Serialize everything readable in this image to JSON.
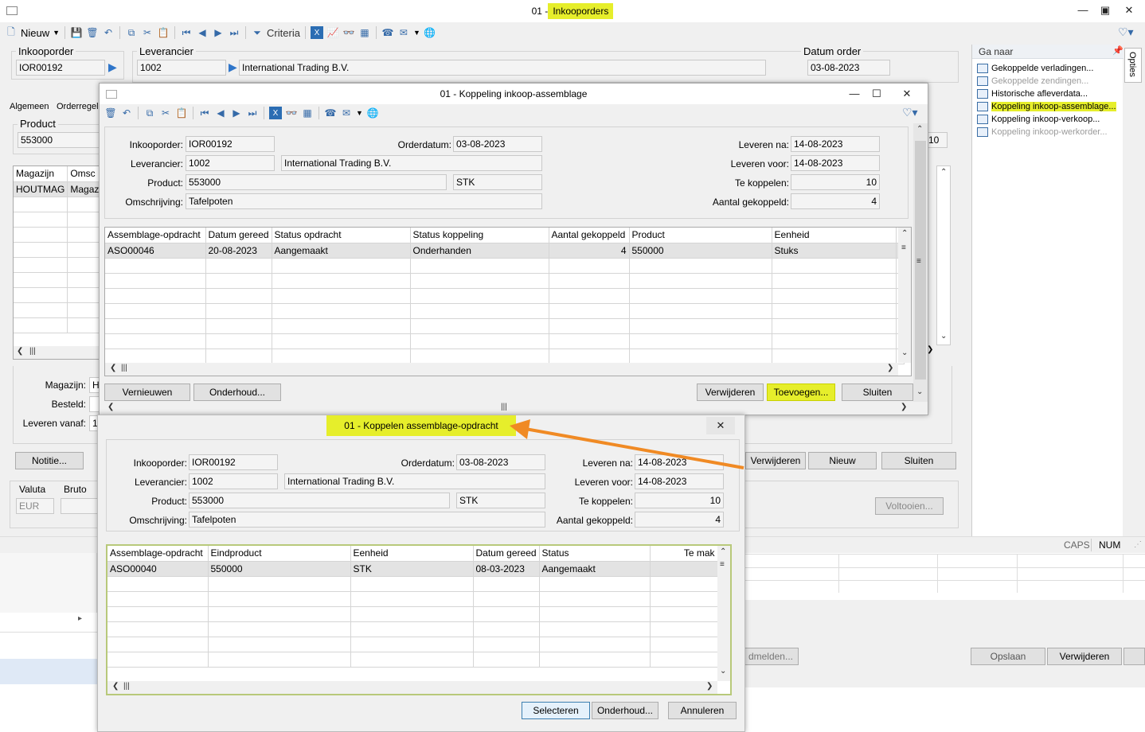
{
  "main": {
    "title_prefix": "01 - ",
    "title": "Inkooporders",
    "toolbar": {
      "new_label": "Nieuw",
      "criteria_label": "Criteria"
    },
    "order_label": "Inkooporder",
    "order_value": "IOR00192",
    "supplier_label": "Leverancier",
    "supplier_code": "1002",
    "supplier_name": "International Trading B.V.",
    "date_label": "Datum order",
    "date_value": "03-08-2023",
    "tabs": [
      "Algemeen",
      "Orderregel"
    ],
    "product_label": "Product",
    "product_value": "553000",
    "right_value": "10",
    "grid_headers": [
      "Magazijn",
      "Omsc"
    ],
    "grid_row": [
      "HOUTMAG",
      "Magaz"
    ],
    "magazijn_label": "Magazijn:",
    "magazijn_value": "H",
    "besteld_label": "Besteld:",
    "leveren_vanaf_label": "Leveren vanaf:",
    "leveren_vanaf_value": "1",
    "notitie_btn": "Notitie...",
    "verwijderen_btn": "Verwijderen",
    "nieuw_btn": "Nieuw",
    "sluiten_btn": "Sluiten",
    "valuta_label": "Valuta",
    "bruto_label": "Bruto",
    "valuta_value": "EUR",
    "voltooien_btn": "Voltooien...",
    "status_caps": "CAPS",
    "status_num": "NUM",
    "bottom_btns": {
      "afmelden": "dmelden...",
      "opslaan": "Opslaan",
      "verwijderen": "Verwijderen"
    }
  },
  "goto": {
    "title": "Ga naar",
    "tab": "Opties",
    "items": [
      {
        "label": "Gekoppelde verladingen...",
        "disabled": false
      },
      {
        "label": "Gekoppelde zendingen...",
        "disabled": true
      },
      {
        "label": "Historische afleverdata...",
        "disabled": false
      },
      {
        "label": "Koppeling inkoop-assemblage...",
        "disabled": false
      },
      {
        "label": "Koppeling inkoop-verkoop...",
        "disabled": false
      },
      {
        "label": "Koppeling inkoop-werkorder...",
        "disabled": true
      }
    ]
  },
  "dlg1": {
    "title": "01 - Koppeling inkoop-assemblage",
    "inkooporder_label": "Inkooporder:",
    "inkooporder": "IOR00192",
    "orderdatum_label": "Orderdatum:",
    "orderdatum": "03-08-2023",
    "leveren_na_label": "Leveren na:",
    "leveren_na": "14-08-2023",
    "leverancier_label": "Leverancier:",
    "leverancier_code": "1002",
    "leverancier_name": "International Trading B.V.",
    "leveren_voor_label": "Leveren voor:",
    "leveren_voor": "14-08-2023",
    "product_label": "Product:",
    "product": "553000",
    "unit": "STK",
    "te_koppelen_label": "Te koppelen:",
    "te_koppelen": "10",
    "omschrijving_label": "Omschrijving:",
    "omschrijving": "Tafelpoten",
    "aantal_gekoppeld_label": "Aantal gekoppeld:",
    "aantal_gekoppeld": "4",
    "headers": [
      "Assemblage-opdracht",
      "Datum gereed",
      "Status opdracht",
      "Status koppeling",
      "Aantal gekoppeld",
      "Product",
      "Eenheid",
      "("
    ],
    "rows": [
      [
        "ASO00046",
        "20-08-2023",
        "Aangemaakt",
        "Onderhanden",
        "4",
        "550000",
        "Stuks",
        ""
      ]
    ],
    "btn_vernieuwen": "Vernieuwen",
    "btn_onderhoud": "Onderhoud...",
    "btn_verwijderen": "Verwijderen",
    "btn_toevoegen": "Toevoegen...",
    "btn_sluiten": "Sluiten"
  },
  "dlg2": {
    "title": "01 - Koppelen assemblage-opdracht",
    "inkooporder_label": "Inkooporder:",
    "inkooporder": "IOR00192",
    "orderdatum_label": "Orderdatum:",
    "orderdatum": "03-08-2023",
    "leveren_na_label": "Leveren na:",
    "leveren_na": "14-08-2023",
    "leverancier_label": "Leverancier:",
    "leverancier_code": "1002",
    "leverancier_name": "International Trading B.V.",
    "leveren_voor_label": "Leveren voor:",
    "leveren_voor": "14-08-2023",
    "product_label": "Product:",
    "product": "553000",
    "unit": "STK",
    "te_koppelen_label": "Te koppelen:",
    "te_koppelen": "10",
    "omschrijving_label": "Omschrijving:",
    "omschrijving": "Tafelpoten",
    "aantal_gekoppeld_label": "Aantal gekoppeld:",
    "aantal_gekoppeld": "4",
    "headers": [
      "Assemblage-opdracht",
      "Eindproduct",
      "Eenheid",
      "Datum gereed",
      "Status",
      "Te mak"
    ],
    "rows": [
      [
        "ASO00040",
        "550000",
        "STK",
        "08-03-2023",
        "Aangemaakt",
        ""
      ]
    ],
    "btn_selecteren": "Selecteren",
    "btn_onderhoud": "Onderhoud...",
    "btn_annuleren": "Annuleren"
  },
  "colors": {
    "highlight": "#e6ee2b",
    "arrow": "#f08a24"
  }
}
